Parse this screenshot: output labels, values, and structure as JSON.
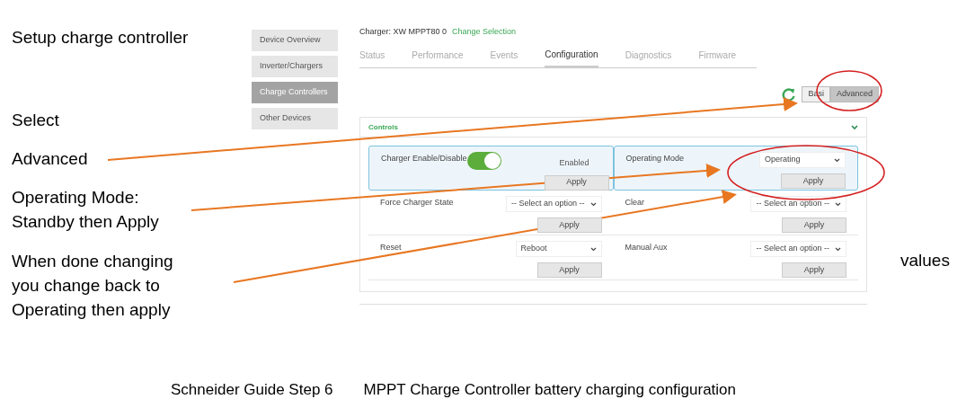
{
  "captions": [
    {
      "lines": [
        "Setup charge controller"
      ]
    },
    {
      "lines": [
        "Select"
      ]
    },
    {
      "lines": [
        "Advanced"
      ]
    },
    {
      "lines": [
        "Operating Mode:",
        "Standby then Apply"
      ]
    },
    {
      "lines": [
        "When done changing",
        "you change back to",
        "Operating then apply"
      ]
    }
  ],
  "side_note": "values",
  "footer": [
    "Schneider Guide Step 6",
    "MPPT Charge Controller battery charging configuration"
  ],
  "screen": {
    "sidebar": [
      {
        "label": "Device Overview",
        "selected": false
      },
      {
        "label": "Inverter/Chargers",
        "selected": false
      },
      {
        "label": "Charge Controllers",
        "selected": true
      },
      {
        "label": "Other Devices",
        "selected": false
      }
    ],
    "charger": "Charger: XW MPPT80 0",
    "change_link": "Change Selection",
    "tabs": [
      {
        "label": "Status",
        "selected": false
      },
      {
        "label": "Performance",
        "selected": false
      },
      {
        "label": "Events",
        "selected": false
      },
      {
        "label": "Configuration",
        "selected": true
      },
      {
        "label": "Diagnostics",
        "selected": false
      },
      {
        "label": "Firmware",
        "selected": false
      }
    ],
    "view_modes": [
      {
        "label": "Basi",
        "selected": false
      },
      {
        "label": "Advanced",
        "selected": true
      }
    ],
    "panel": {
      "title": "Controls",
      "expanded": true,
      "cells": [
        {
          "label": "Charger Enable/Disable",
          "kind": "toggle",
          "on": true,
          "value": "Enabled",
          "button": "Apply",
          "highlighted": true
        },
        {
          "label": "Operating Mode",
          "kind": "select",
          "value": "Operating",
          "button": "Apply",
          "highlighted": true
        },
        {
          "label": "Force Charger State",
          "kind": "select",
          "value": "-- Select an option --",
          "button": "Apply",
          "highlighted": false
        },
        {
          "label": "Clear",
          "kind": "select",
          "value": "-- Select an option --",
          "button": "Apply",
          "highlighted": false
        },
        {
          "label": "Reset",
          "kind": "select",
          "value": "Reboot",
          "button": "Apply",
          "highlighted": false
        },
        {
          "label": "Manual Aux",
          "kind": "select",
          "value": "-- Select an option --",
          "button": "Apply",
          "highlighted": false
        }
      ]
    }
  }
}
